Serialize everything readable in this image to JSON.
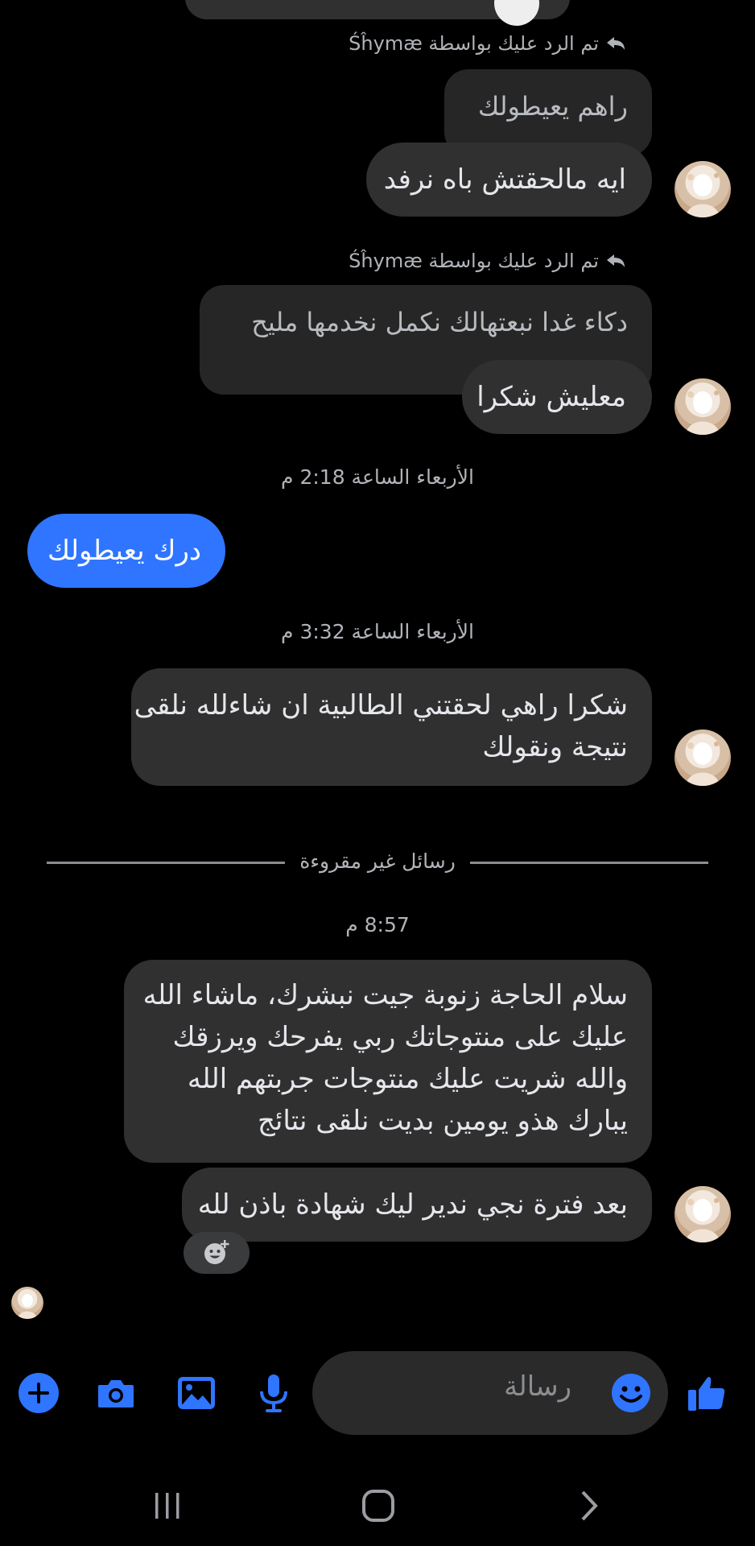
{
  "colors": {
    "accent": "#2f75ff",
    "background": "#000000",
    "bubble": "#303030"
  },
  "conversation": {
    "reply_label_1": "تم الرد عليك بواسطة Śĥymæ",
    "quoted_1": "راهم يعيطولك",
    "msg_1": "ايه مالحقتش باه نرفد",
    "reply_label_2": "تم الرد عليك بواسطة Śĥymæ",
    "quoted_2": "دكاء غدا نبعتهالك نكمل نخدمها مليح",
    "msg_2": "معليش شكرا",
    "timestamp_1": "الأربعاء الساعة 2:18 م",
    "my_msg": "درك يعيطولك",
    "timestamp_2": "الأربعاء الساعة 3:32 م",
    "msg_3_line1": "شكرا راهي لحقتني الطالبية ان شاءلله نلقى",
    "msg_3_line2": "نتيجة ونقولك",
    "unread_divider": "رسائل غير مقروءة",
    "timestamp_3": "8:57 م",
    "msg_4_line1": "سلام الحاجة زنوبة  جيت نبشرك، ماشاء الله",
    "msg_4_line2": "عليك  على منتوجاتك ربي يفرحك ويرزقك",
    "msg_4_line3": "والله شريت عليك منتوجات جربتهم الله",
    "msg_4_line4": "يبارك هذو يومين بديت نلقى نتائج",
    "msg_5": "بعد فترة نجي ندير ليك شهادة باذن لله"
  },
  "composer": {
    "placeholder": "رسالة",
    "icons": [
      "plus-icon",
      "camera-icon",
      "gallery-icon",
      "microphone-icon",
      "emoji-icon",
      "like-icon"
    ]
  },
  "navbar": {
    "icons": [
      "recent-apps-icon",
      "home-icon",
      "back-icon"
    ]
  }
}
